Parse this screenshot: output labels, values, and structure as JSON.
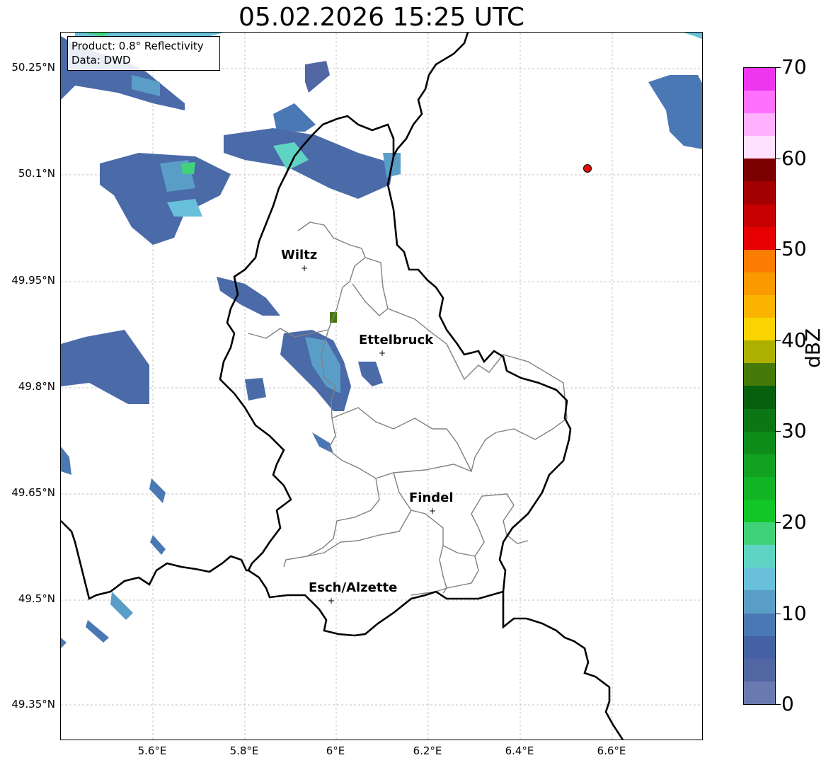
{
  "title": "05.02.2026 15:25 UTC",
  "info": {
    "product": "Product: 0.8° Reflectivity",
    "source": "Data: DWD"
  },
  "lat_labels": [
    "50.25°N",
    "50.1°N",
    "49.95°N",
    "49.8°N",
    "49.65°N",
    "49.5°N",
    "49.35°N"
  ],
  "lon_labels": [
    "5.6°E",
    "5.8°E",
    "6°E",
    "6.2°E",
    "6.4°E",
    "6.6°E"
  ],
  "cities": [
    {
      "name": "Wiltz"
    },
    {
      "name": "Ettelbruck"
    },
    {
      "name": "Findel"
    },
    {
      "name": "Esch/Alzette"
    }
  ],
  "colorbar": {
    "label": "dBZ",
    "ticks": [
      "0",
      "10",
      "20",
      "30",
      "40",
      "50",
      "60",
      "70"
    ],
    "colors": [
      "#6a7ab0",
      "#5266a4",
      "#4660a6",
      "#4a78b4",
      "#5a9ec8",
      "#68c0da",
      "#60d4c4",
      "#40d27a",
      "#12c628",
      "#10b424",
      "#12a220",
      "#0e8c1a",
      "#0c7614",
      "#06600e",
      "#467a08",
      "#aeb000",
      "#fad400",
      "#fab400",
      "#fa9a00",
      "#fa7c00",
      "#e60000",
      "#c60000",
      "#a20000",
      "#7c0000",
      "#ffe0ff",
      "#ffb0ff",
      "#ff70ff",
      "#ee36ee"
    ]
  },
  "colors": {
    "border": "#000000",
    "canton_border": "#808080",
    "grid": "#b0b0b0",
    "marker": "#e01010"
  }
}
